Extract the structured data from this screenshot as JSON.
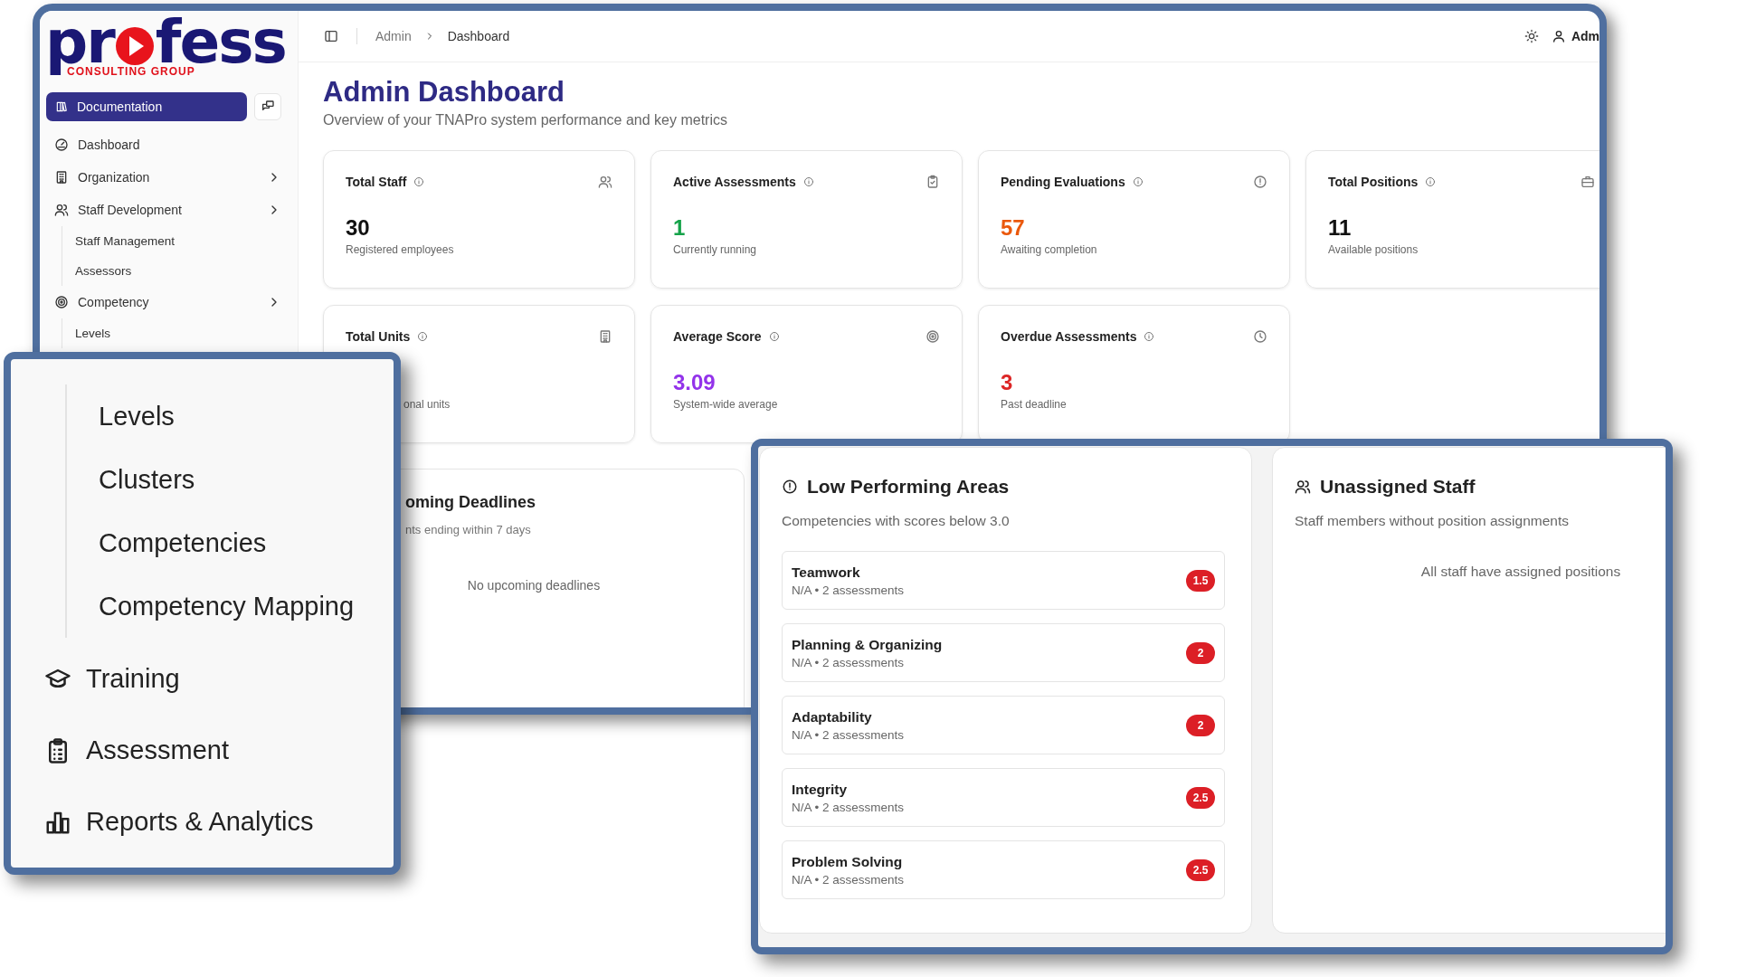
{
  "logo": {
    "left": "pr",
    "right": "fess",
    "tagline": "CONSULTING GROUP"
  },
  "sidebar": {
    "documentation": "Documentation",
    "items": [
      {
        "label": "Dashboard",
        "expandable": false
      },
      {
        "label": "Organization",
        "expandable": true
      },
      {
        "label": "Staff Development",
        "expandable": true,
        "children": [
          {
            "label": "Staff Management"
          },
          {
            "label": "Assessors"
          }
        ]
      },
      {
        "label": "Competency",
        "expandable": true,
        "children": [
          {
            "label": "Levels"
          }
        ]
      }
    ]
  },
  "header": {
    "breadcrumb": [
      "Admin",
      "Dashboard"
    ],
    "user": "Adm"
  },
  "page": {
    "title": "Admin Dashboard",
    "subtitle": "Overview of your TNAPro system performance and key metrics"
  },
  "stats": [
    {
      "title": "Total Staff",
      "value": "30",
      "caption": "Registered employees",
      "color": "#111111"
    },
    {
      "title": "Active Assessments",
      "value": "1",
      "caption": "Currently running",
      "color": "#16a34a"
    },
    {
      "title": "Pending Evaluations",
      "value": "57",
      "caption": "Awaiting completion",
      "color": "#ea580c"
    },
    {
      "title": "Total Positions",
      "value": "11",
      "caption": "Available positions",
      "color": "#111111"
    },
    {
      "title": "Total Units",
      "caption": "onal units"
    },
    {
      "title": "Average Score",
      "value": "3.09",
      "caption": "System-wide average",
      "color": "#9333ea"
    },
    {
      "title": "Overdue Assessments",
      "value": "3",
      "caption": "Past deadline",
      "color": "#dc2626"
    }
  ],
  "deadlines": {
    "title": "oming Deadlines",
    "subtitle": "nts ending within 7 days",
    "empty": "No upcoming deadlines"
  },
  "zoom_nav": {
    "items": [
      {
        "label": "Levels",
        "kind": "sub"
      },
      {
        "label": "Clusters",
        "kind": "sub"
      },
      {
        "label": "Competencies",
        "kind": "sub"
      },
      {
        "label": "Competency Mapping",
        "kind": "sub"
      },
      {
        "label": "Training",
        "kind": "main"
      },
      {
        "label": "Assessment",
        "kind": "main"
      },
      {
        "label": "Reports & Analytics",
        "kind": "main"
      }
    ]
  },
  "low_performing": {
    "title": "Low Performing Areas",
    "subtitle": "Competencies with scores below 3.0",
    "items": [
      {
        "name": "Teamwork",
        "detail": "N/A • 2 assessments",
        "score": "1.5"
      },
      {
        "name": "Planning & Organizing",
        "detail": "N/A • 2 assessments",
        "score": "2"
      },
      {
        "name": "Adaptability",
        "detail": "N/A • 2 assessments",
        "score": "2"
      },
      {
        "name": "Integrity",
        "detail": "N/A • 2 assessments",
        "score": "2.5"
      },
      {
        "name": "Problem Solving",
        "detail": "N/A • 2 assessments",
        "score": "2.5"
      }
    ]
  },
  "unassigned": {
    "title": "Unassigned Staff",
    "subtitle": "Staff members without position assignments",
    "empty": "All staff have assigned positions"
  }
}
